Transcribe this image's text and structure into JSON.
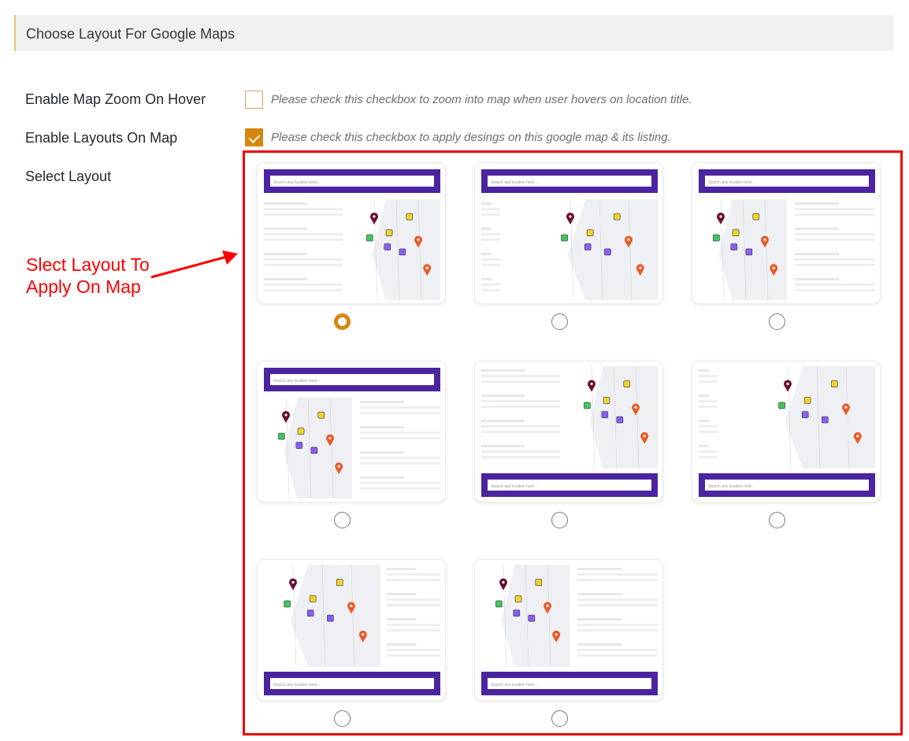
{
  "section": {
    "title": "Choose Layout For Google Maps"
  },
  "settings": {
    "zoom_hover": {
      "label": "Enable Map Zoom On Hover",
      "checked": false,
      "hint": "Please check this checkbox to zoom into map when user hovers on location title."
    },
    "layouts_on_map": {
      "label": "Enable Layouts On Map",
      "checked": true,
      "hint": "Please check this checkbox to apply desings on this google map & its listing."
    },
    "select_layout": {
      "label": "Select Layout"
    }
  },
  "annotation": {
    "line1": "Slect Layout To",
    "line2": "Apply On Map"
  },
  "layouts": {
    "search_placeholder": "Search any location here...",
    "selected_index": 0,
    "items": [
      {
        "map_side": "right",
        "search": "top",
        "selected": true
      },
      {
        "map_side": "right-wide",
        "search": "top",
        "selected": false
      },
      {
        "map_side": "left",
        "search": "top",
        "selected": false
      },
      {
        "map_side": "left",
        "search": "top",
        "selected": false
      },
      {
        "map_side": "right",
        "search": "bottom",
        "selected": false
      },
      {
        "map_side": "right-wide",
        "search": "bottom",
        "selected": false
      },
      {
        "map_side": "left-wide",
        "search": "bottom",
        "selected": false
      },
      {
        "map_side": "left",
        "search": "bottom",
        "selected": false
      }
    ]
  },
  "colors": {
    "accent": "#d5860f",
    "highlight": "#ee0000",
    "search_bar": "#4b24a0"
  }
}
